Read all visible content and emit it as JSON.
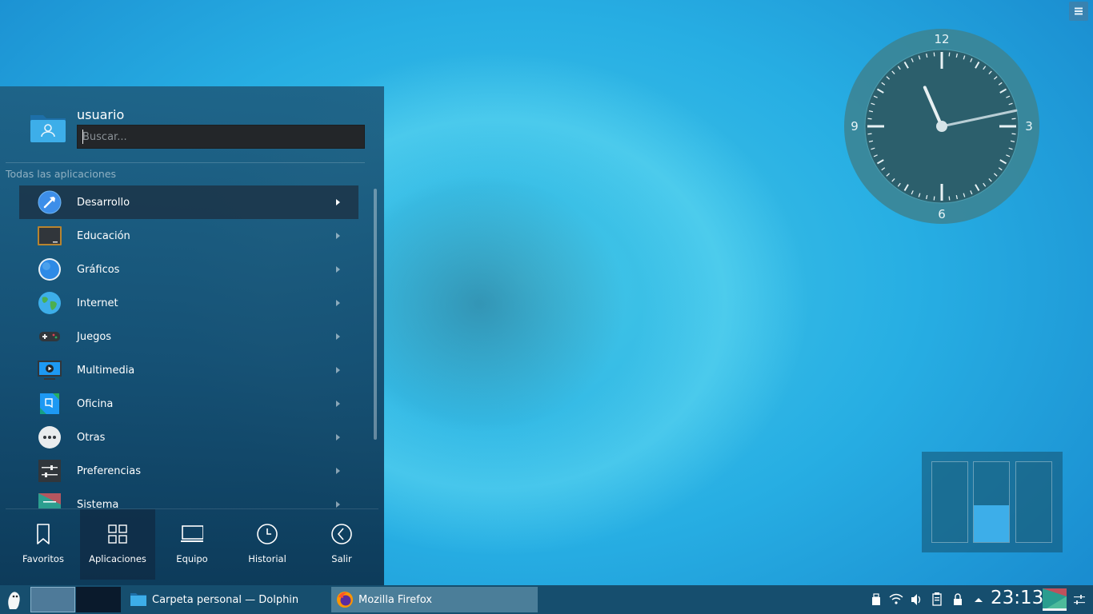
{
  "launcher": {
    "username": "usuario",
    "search_placeholder": "Buscar...",
    "section_title": "Todas las aplicaciones",
    "items": [
      {
        "label": "Desarrollo",
        "icon": "hammer-icon"
      },
      {
        "label": "Educación",
        "icon": "chalkboard-icon"
      },
      {
        "label": "Gráficos",
        "icon": "globe-blue-icon"
      },
      {
        "label": "Internet",
        "icon": "earth-icon"
      },
      {
        "label": "Juegos",
        "icon": "gamepad-icon"
      },
      {
        "label": "Multimedia",
        "icon": "monitor-play-icon"
      },
      {
        "label": "Oficina",
        "icon": "office-icon"
      },
      {
        "label": "Otras",
        "icon": "more-dots-icon"
      },
      {
        "label": "Preferencias",
        "icon": "sliders-icon"
      },
      {
        "label": "Sistema",
        "icon": "system-icon"
      }
    ],
    "tabs": [
      {
        "label": "Favoritos",
        "icon": "bookmark-icon"
      },
      {
        "label": "Aplicaciones",
        "icon": "grid-icon",
        "active": true
      },
      {
        "label": "Equipo",
        "icon": "laptop-icon"
      },
      {
        "label": "Historial",
        "icon": "clock-icon"
      },
      {
        "label": "Salir",
        "icon": "back-circle-icon"
      }
    ]
  },
  "clock_widget": {
    "numerals": {
      "top": "12",
      "right": "3",
      "bottom": "6",
      "left": "9"
    },
    "time": {
      "hours": 23,
      "minutes": 13
    }
  },
  "taskbar": {
    "tasks": [
      {
        "label": "Carpeta personal — Dolphin",
        "icon": "folder-icon"
      },
      {
        "label": "Mozilla Firefox",
        "icon": "firefox-icon"
      }
    ],
    "clock": "23:13"
  },
  "colors": {
    "accent": "#3daee9",
    "panel": "#164e6e"
  }
}
